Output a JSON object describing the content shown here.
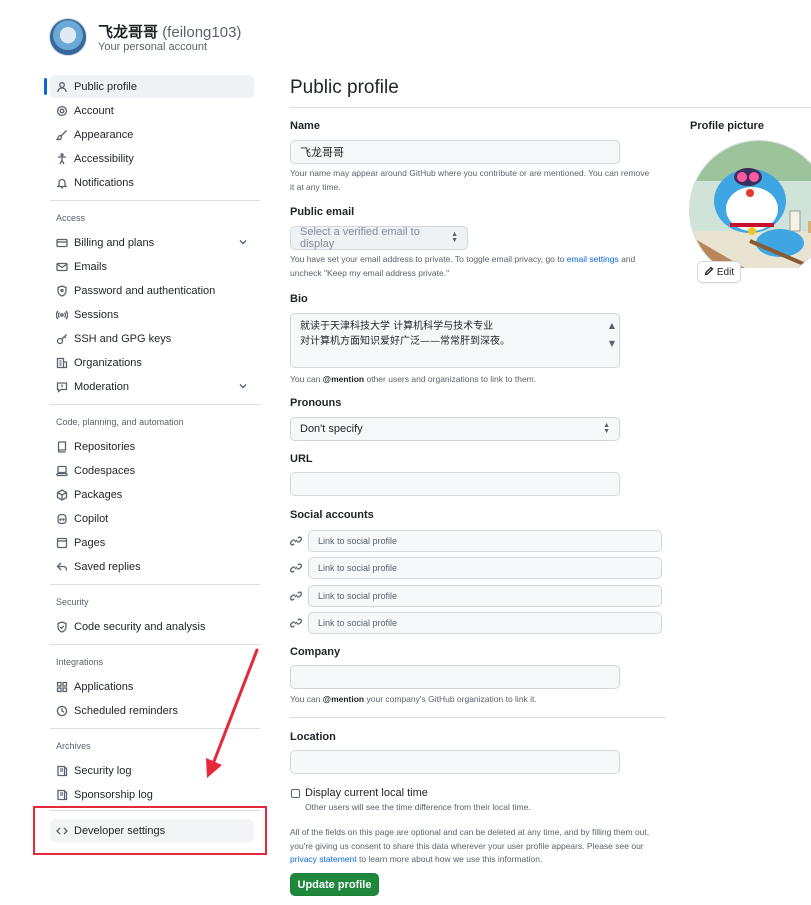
{
  "account": {
    "display_name": "飞龙哥哥",
    "login": "(feilong103)",
    "subtitle": "Your personal account"
  },
  "sidebar": {
    "items_top": [
      {
        "label": "Public profile",
        "icon": "person-icon",
        "active": true
      },
      {
        "label": "Account",
        "icon": "gear-icon"
      },
      {
        "label": "Appearance",
        "icon": "paintbrush-icon"
      },
      {
        "label": "Accessibility",
        "icon": "accessibility-icon"
      },
      {
        "label": "Notifications",
        "icon": "bell-icon"
      }
    ],
    "group_access": "Access",
    "items_access": [
      {
        "label": "Billing and plans",
        "icon": "credit-card-icon",
        "expandable": true
      },
      {
        "label": "Emails",
        "icon": "mail-icon"
      },
      {
        "label": "Password and authentication",
        "icon": "shield-lock-icon"
      },
      {
        "label": "Sessions",
        "icon": "broadcast-icon"
      },
      {
        "label": "SSH and GPG keys",
        "icon": "key-icon"
      },
      {
        "label": "Organizations",
        "icon": "organization-icon"
      },
      {
        "label": "Moderation",
        "icon": "report-icon",
        "expandable": true
      }
    ],
    "group_code": "Code, planning, and automation",
    "items_code": [
      {
        "label": "Repositories",
        "icon": "repo-icon"
      },
      {
        "label": "Codespaces",
        "icon": "codespaces-icon"
      },
      {
        "label": "Packages",
        "icon": "package-icon"
      },
      {
        "label": "Copilot",
        "icon": "copilot-icon"
      },
      {
        "label": "Pages",
        "icon": "browser-icon"
      },
      {
        "label": "Saved replies",
        "icon": "reply-icon"
      }
    ],
    "group_security": "Security",
    "items_security": [
      {
        "label": "Code security and analysis",
        "icon": "shield-check-icon"
      }
    ],
    "group_integrations": "Integrations",
    "items_integrations": [
      {
        "label": "Applications",
        "icon": "apps-icon"
      },
      {
        "label": "Scheduled reminders",
        "icon": "clock-icon"
      }
    ],
    "group_archives": "Archives",
    "items_archives": [
      {
        "label": "Security log",
        "icon": "log-icon"
      },
      {
        "label": "Sponsorship log",
        "icon": "log-icon"
      }
    ],
    "developer_settings": "Developer settings"
  },
  "main": {
    "title": "Public profile",
    "name_label": "Name",
    "name_value": "飞龙哥哥",
    "name_note": "Your name may appear around GitHub where you contribute or are mentioned. You can remove it at any time.",
    "email_label": "Public email",
    "email_select": "Select a verified email to display",
    "email_note_1": "You have set your email address to private. To toggle email privacy, go to ",
    "email_note_link": "email settings",
    "email_note_2": " and uncheck \"Keep my email address private.\"",
    "bio_label": "Bio",
    "bio_line1": "就读于天津科技大学 计算机科学与技术专业",
    "bio_line2": "对计算机方面知识爱好广泛——常常肝到深夜。",
    "bio_note_1": "You can ",
    "bio_note_mention": "@mention",
    "bio_note_2": " other users and organizations to link to them.",
    "pronouns_label": "Pronouns",
    "pronouns_value": "Don't specify",
    "url_label": "URL",
    "url_value": "",
    "social_label": "Social accounts",
    "social_placeholder": "Link to social profile",
    "company_label": "Company",
    "company_value": "",
    "company_note_1": "You can ",
    "company_note_mention": "@mention",
    "company_note_2": " your company's GitHub organization to link it.",
    "location_label": "Location",
    "location_value": "",
    "local_time_label": "Display current local time",
    "local_time_note": "Other users will see the time difference from their local time.",
    "footer_note_1": "All of the fields on this page are optional and can be deleted at any time, and by filling them out, you're giving us consent to share this data wherever your user profile appears. Please see our ",
    "footer_note_link": "privacy statement",
    "footer_note_2": " to learn more about how we use this information.",
    "update_button": "Update profile"
  },
  "profile_picture": {
    "label": "Profile picture",
    "edit_button": "Edit"
  },
  "colors": {
    "accent": "#0969da",
    "primary_button": "#1f883d",
    "annotation": "#e5283a"
  }
}
